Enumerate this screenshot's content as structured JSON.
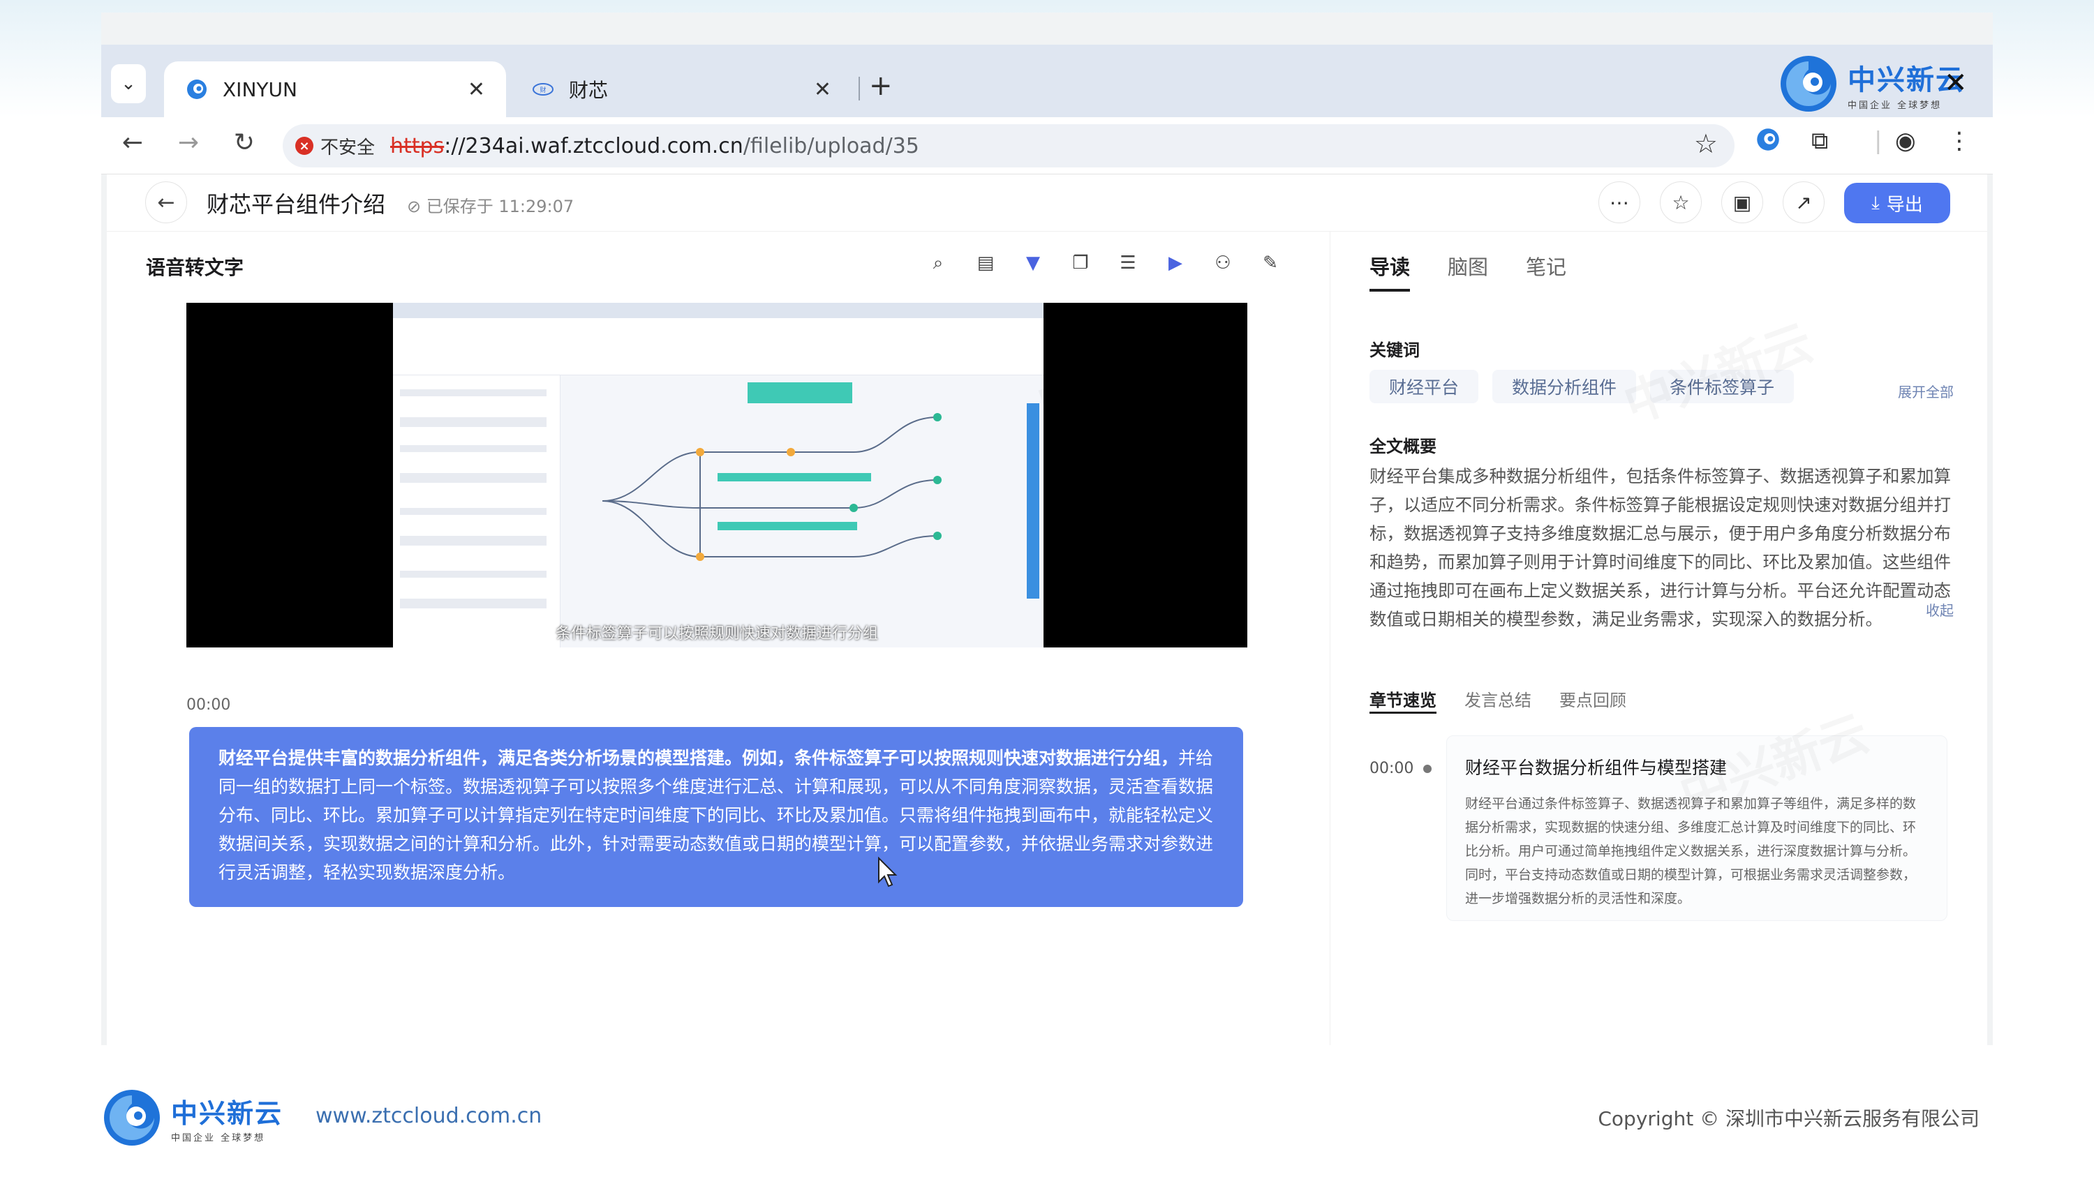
{
  "browser": {
    "tabs": [
      {
        "title": "XINYUN",
        "active": true
      },
      {
        "title": "财芯",
        "active": false
      }
    ],
    "security_label": "不安全",
    "url": {
      "scheme": "https",
      "rest_host": "://234ai.waf.ztccloud.com.cn",
      "path": "/filelib/upload/35"
    },
    "brand": {
      "name": "中兴新云",
      "tagline": "中国企业 全球梦想"
    }
  },
  "header": {
    "title": "财芯平台组件介绍",
    "saved_status": "已保存于 11:29:07",
    "export_label": "导出"
  },
  "left": {
    "panel_title": "语音转文字",
    "video_caption": "条件标签算子可以按照规则快速对数据进行分组",
    "timestamp": "00:00",
    "transcript_bold": "财经平台提供丰富的数据分析组件，满足各类分析场景的模型搭建。例如，条件标签算子可以按照规则快速对数据进行分组，",
    "transcript_rest": "并给同一组的数据打上同一个标签。数据透视算子可以按照多个维度进行汇总、计算和展现，可以从不同角度洞察数据，灵活查看数据分布、同比、环比。累加算子可以计算指定列在特定时间维度下的同比、环比及累加值。只需将组件拖拽到画布中，就能轻松定义数据间关系，实现数据之间的计算和分析。此外，针对需要动态数值或日期的模型计算，可以配置参数，并依据业务需求对参数进行灵活调整，轻松实现数据深度分析。"
  },
  "right": {
    "tabs": [
      "导读",
      "脑图",
      "笔记"
    ],
    "keywords_title": "关键词",
    "keywords": [
      "财经平台",
      "数据分析组件",
      "条件标签算子"
    ],
    "expand_all": "展开全部",
    "summary_title": "全文概要",
    "summary": "财经平台集成多种数据分析组件，包括条件标签算子、数据透视算子和累加算子，以适应不同分析需求。条件标签算子能根据设定规则快速对数据分组并打标，数据透视算子支持多维度数据汇总与展示，便于用户多角度分析数据分布和趋势，而累加算子则用于计算时间维度下的同比、环比及累加值。这些组件通过拖拽即可在画布上定义数据关系，进行计算与分析。平台还允许配置动态数值或日期相关的模型参数，满足业务需求，实现深入的数据分析。",
    "collapse": "收起",
    "subtabs": [
      "章节速览",
      "发言总结",
      "要点回顾"
    ],
    "chapter": {
      "time": "00:00",
      "title": "财经平台数据分析组件与模型搭建",
      "body": "财经平台通过条件标签算子、数据透视算子和累加算子等组件，满足多样的数据分析需求，实现数据的快速分组、多维度汇总计算及时间维度下的同比、环比分析。用户可通过简单拖拽组件定义数据关系，进行深度数据计算与分析。同时，平台支持动态数值或日期的模型计算，可根据业务需求灵活调整参数，进一步增强数据分析的灵活性和深度。"
    }
  },
  "footer": {
    "brand": "中兴新云",
    "tagline": "中国企业 全球梦想",
    "url": "www.ztccloud.com.cn",
    "copyright": "Copyright © 深圳市中兴新云服务有限公司"
  },
  "colors": {
    "accent": "#4f77f0",
    "transcript_bg": "#5b80ea",
    "brand_blue": "#1f6fd8",
    "insecure_red": "#d93025"
  }
}
